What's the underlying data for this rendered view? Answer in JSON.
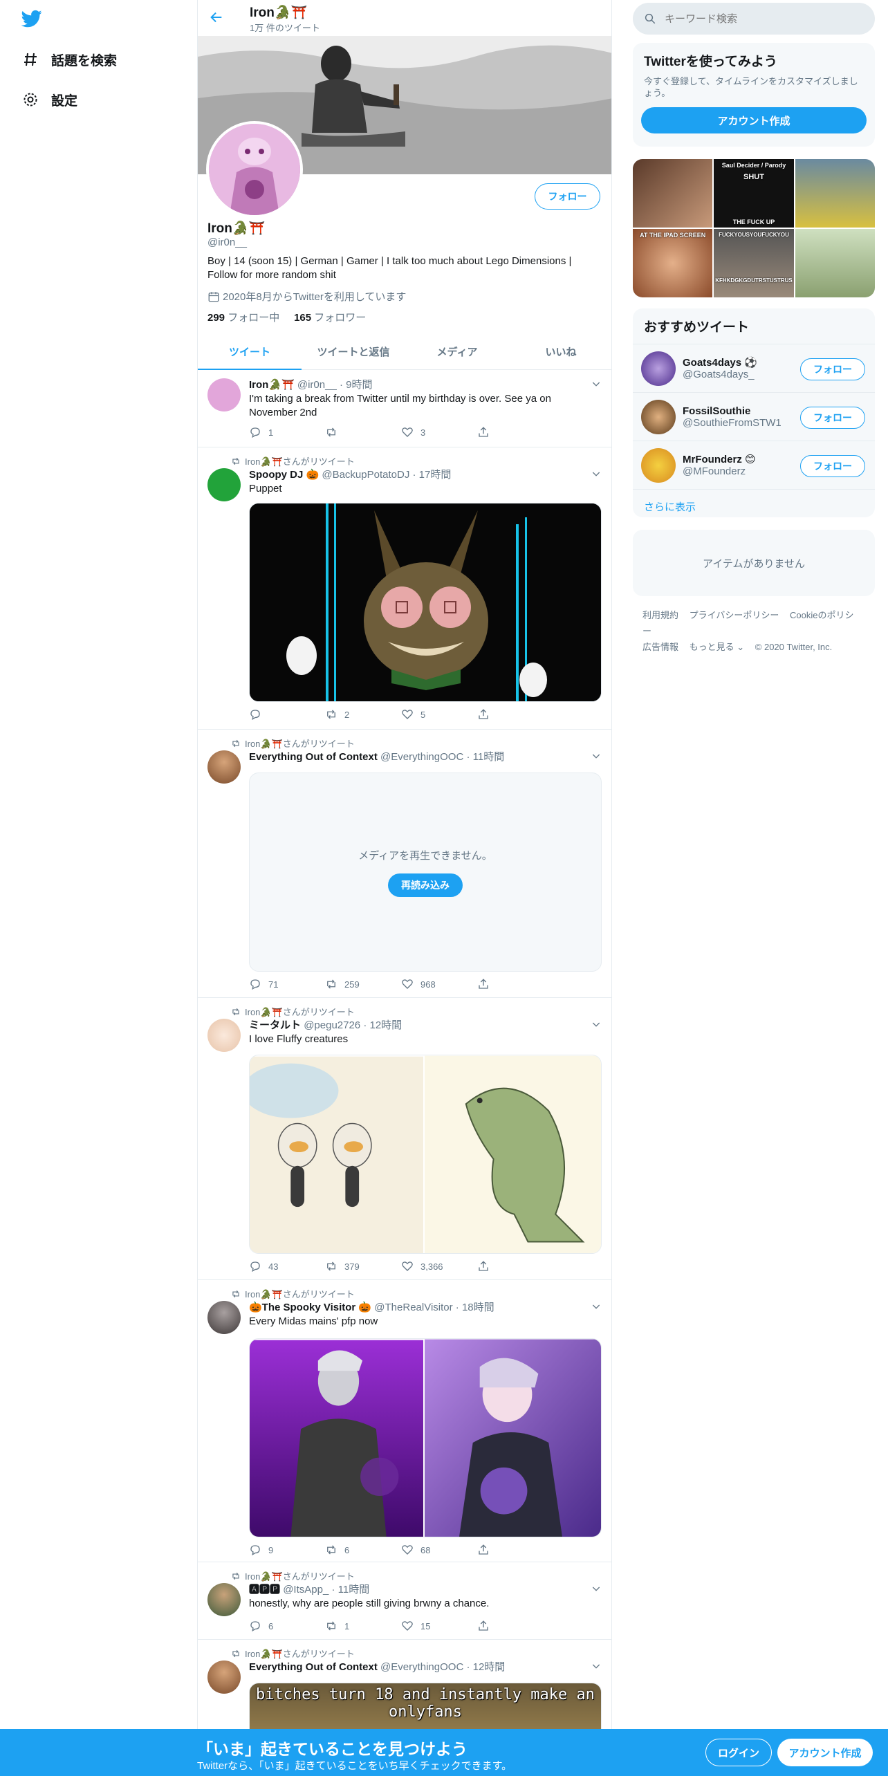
{
  "colors": {
    "accent": "#1da1f2",
    "text": "#14171a",
    "muted": "#657786",
    "border": "#e6ecf0",
    "panel": "#f5f8fa"
  },
  "nav": {
    "logo_icon": "twitter-bird-icon",
    "items": [
      {
        "label": "話題を検索",
        "icon": "hashtag-icon"
      },
      {
        "label": "設定",
        "icon": "gear-icon"
      }
    ]
  },
  "header": {
    "title": "Iron🐊⛩️",
    "subtitle": "1万 件のツイート"
  },
  "profile": {
    "follow_label": "フォロー",
    "name": "Iron🐊⛩️",
    "handle": "@ir0n__",
    "bio": "Boy | 14 (soon 15) | German | Gamer | I talk too much about Lego Dimensions | Follow for more random shit",
    "joined": "2020年8月からTwitterを利用しています",
    "following_count": "299",
    "following_label": "フォロー中",
    "followers_count": "165",
    "followers_label": "フォロワー"
  },
  "tabs": [
    "ツイート",
    "ツイートと返信",
    "メディア",
    "いいね"
  ],
  "retweet_label": "Iron🐊⛩️さんがリツイート",
  "tweets": [
    {
      "name": "Iron🐊⛩️",
      "handle": "@ir0n__",
      "time": "9時間",
      "text": "I'm taking a break from Twitter until my birthday is over. See ya on November 2nd",
      "replies": "1",
      "retweets": "",
      "likes": "3"
    },
    {
      "name": "Spoopy DJ 🎃",
      "handle": "@BackupPotatoDJ",
      "time": "17時間",
      "text": "Puppet",
      "replies": "",
      "retweets": "2",
      "likes": "5"
    },
    {
      "name": "Everything Out of Context",
      "handle": "@EverythingOOC",
      "time": "11時間",
      "text": "",
      "replies": "71",
      "retweets": "259",
      "likes": "968",
      "media_error": "メディアを再生できません。",
      "reload_label": "再読み込み"
    },
    {
      "name": "ミータルト",
      "handle": "@pegu2726",
      "time": "12時間",
      "text": "I love Fluffy creatures",
      "replies": "43",
      "retweets": "379",
      "likes": "3,366"
    },
    {
      "name": "🎃The Spooky Visitor 🎃",
      "handle": "@TheRealVisitor",
      "time": "18時間",
      "text": "Every Midas mains' pfp now",
      "replies": "9",
      "retweets": "6",
      "likes": "68"
    },
    {
      "name": "🅰🅿🅿",
      "handle": "@ItsApp_",
      "time": "11時間",
      "text": "honestly, why are people still giving brwny a chance.",
      "replies": "6",
      "retweets": "1",
      "likes": "15"
    },
    {
      "name": "Everything Out of Context",
      "handle": "@EverythingOOC",
      "time": "12時間",
      "text": "",
      "media_caption": "bitches turn 18 and instantly make an onlyfans"
    }
  ],
  "sidebar": {
    "search_placeholder": "キーワード検索",
    "signup_card": {
      "title": "Twitterを使ってみよう",
      "subtitle": "今すぐ登録して、タイムラインをカスタマイズしましょう。",
      "button": "アカウント作成"
    },
    "media_grid": [
      "Saul Decider / Parody",
      "SHUT",
      "THE FUCK UP",
      "AT THE IPAD SCREEN",
      "FUCKYOUSYOUFUCKYOU",
      "KFHKDGKGDUTRSTUSTRUS"
    ],
    "who_to_follow": {
      "title": "おすすめツイート",
      "users": [
        {
          "name": "Goats4days ⚽",
          "handle": "@Goats4days_",
          "button": "フォロー"
        },
        {
          "name": "FossilSouthie",
          "handle": "@SouthieFromSTW1",
          "button": "フォロー"
        },
        {
          "name": "MrFounderz 😊",
          "handle": "@MFounderz",
          "button": "フォロー"
        }
      ],
      "show_more": "さらに表示"
    },
    "trends_empty": "アイテムがありません",
    "footer": {
      "links": [
        "利用規約",
        "プライバシーポリシー",
        "Cookieのポリシー",
        "広告情報",
        "もっと見る ⌄"
      ],
      "copyright": "© 2020 Twitter, Inc."
    }
  },
  "bottom_bar": {
    "title": "「いま」起きていることを見つけよう",
    "subtitle": "Twitterなら、「いま」起きていることをいち早くチェックできます。",
    "login": "ログイン",
    "signup": "アカウント作成"
  }
}
